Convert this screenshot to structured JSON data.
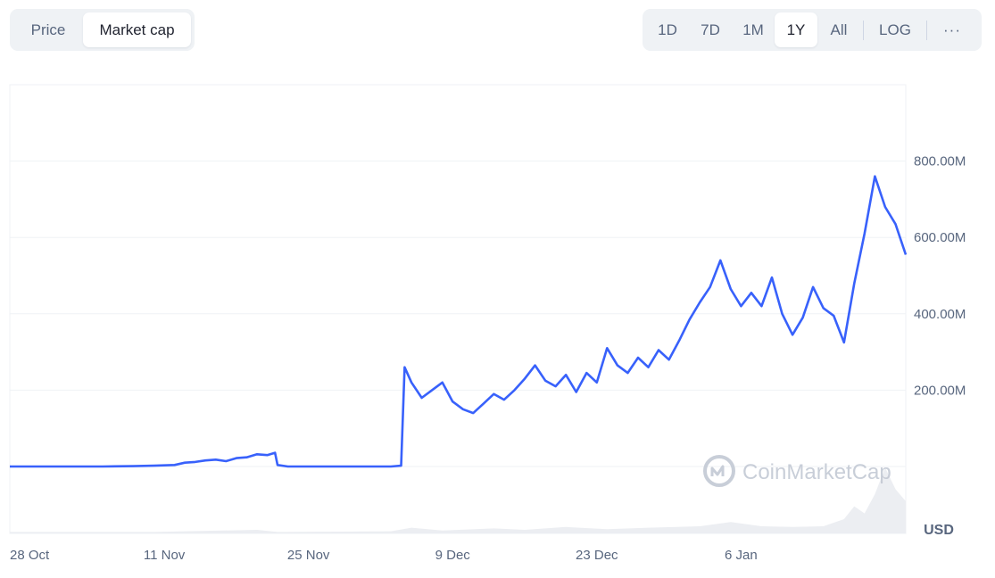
{
  "toggle": {
    "items": [
      {
        "label": "Price",
        "active": false
      },
      {
        "label": "Market cap",
        "active": true
      }
    ]
  },
  "ranges": {
    "items": [
      {
        "label": "1D",
        "active": false
      },
      {
        "label": "7D",
        "active": false
      },
      {
        "label": "1M",
        "active": false
      },
      {
        "label": "1Y",
        "active": true
      },
      {
        "label": "All",
        "active": false
      }
    ],
    "log_label": "LOG",
    "more_label": "···"
  },
  "colors": {
    "line": "#3861fb",
    "volume": "#eceef2",
    "grid": "#eff2f5"
  },
  "watermark": {
    "text": "CoinMarketCap",
    "icon": "coinmarketcap-logo-icon"
  },
  "chart_data": {
    "type": "line",
    "series": [
      {
        "values": [
          [
            "2023-10-27",
            0
          ],
          [
            "2023-11-05",
            0
          ],
          [
            "2023-11-08",
            1
          ],
          [
            "2023-11-10",
            2
          ],
          [
            "2023-11-11",
            3
          ],
          [
            "2023-11-12",
            4
          ],
          [
            "2023-11-13",
            10
          ],
          [
            "2023-11-14",
            12
          ],
          [
            "2023-11-15",
            16
          ],
          [
            "2023-11-16",
            18
          ],
          [
            "2023-11-17",
            14
          ],
          [
            "2023-11-18",
            22
          ],
          [
            "2023-11-19",
            24
          ],
          [
            "2023-11-20",
            32
          ],
          [
            "2023-11-21",
            30
          ],
          [
            "2023-11-21T18:00",
            36
          ],
          [
            "2023-11-22",
            4
          ],
          [
            "2023-11-23",
            0
          ],
          [
            "2023-12-03",
            0
          ],
          [
            "2023-12-04",
            2
          ],
          [
            "2023-12-04T08:00",
            260
          ],
          [
            "2023-12-05",
            220
          ],
          [
            "2023-12-06",
            180
          ],
          [
            "2023-12-07",
            200
          ],
          [
            "2023-12-08",
            220
          ],
          [
            "2023-12-09",
            170
          ],
          [
            "2023-12-10",
            150
          ],
          [
            "2023-12-11",
            140
          ],
          [
            "2023-12-12",
            165
          ],
          [
            "2023-12-13",
            190
          ],
          [
            "2023-12-14",
            175
          ],
          [
            "2023-12-15",
            200
          ],
          [
            "2023-12-16",
            230
          ],
          [
            "2023-12-17",
            265
          ],
          [
            "2023-12-18",
            225
          ],
          [
            "2023-12-19",
            210
          ],
          [
            "2023-12-20",
            240
          ],
          [
            "2023-12-21",
            195
          ],
          [
            "2023-12-22",
            245
          ],
          [
            "2023-12-23",
            220
          ],
          [
            "2023-12-24",
            310
          ],
          [
            "2023-12-25",
            265
          ],
          [
            "2023-12-26",
            245
          ],
          [
            "2023-12-27",
            285
          ],
          [
            "2023-12-28",
            260
          ],
          [
            "2023-12-29",
            305
          ],
          [
            "2023-12-30",
            280
          ],
          [
            "2023-12-31",
            330
          ],
          [
            "2024-01-01",
            385
          ],
          [
            "2024-01-02",
            430
          ],
          [
            "2024-01-03",
            470
          ],
          [
            "2024-01-04",
            540
          ],
          [
            "2024-01-05",
            465
          ],
          [
            "2024-01-06",
            420
          ],
          [
            "2024-01-07",
            455
          ],
          [
            "2024-01-08",
            420
          ],
          [
            "2024-01-09",
            495
          ],
          [
            "2024-01-10",
            400
          ],
          [
            "2024-01-11",
            345
          ],
          [
            "2024-01-12",
            390
          ],
          [
            "2024-01-13",
            470
          ],
          [
            "2024-01-14",
            415
          ],
          [
            "2024-01-15",
            395
          ],
          [
            "2024-01-16",
            325
          ],
          [
            "2024-01-17",
            480
          ],
          [
            "2024-01-18",
            610
          ],
          [
            "2024-01-19",
            760
          ],
          [
            "2024-01-20",
            680
          ],
          [
            "2024-01-21",
            635
          ],
          [
            "2024-01-22",
            555
          ]
        ]
      }
    ],
    "volume": [
      [
        "2023-10-27",
        0.02
      ],
      [
        "2023-11-10",
        0.02
      ],
      [
        "2023-11-20",
        0.05
      ],
      [
        "2023-11-22",
        0.02
      ],
      [
        "2023-12-03",
        0.03
      ],
      [
        "2023-12-05",
        0.08
      ],
      [
        "2023-12-08",
        0.04
      ],
      [
        "2023-12-13",
        0.07
      ],
      [
        "2023-12-16",
        0.05
      ],
      [
        "2023-12-20",
        0.09
      ],
      [
        "2023-12-24",
        0.06
      ],
      [
        "2023-12-28",
        0.08
      ],
      [
        "2024-01-02",
        0.1
      ],
      [
        "2024-01-05",
        0.16
      ],
      [
        "2024-01-08",
        0.1
      ],
      [
        "2024-01-11",
        0.09
      ],
      [
        "2024-01-14",
        0.1
      ],
      [
        "2024-01-16",
        0.2
      ],
      [
        "2024-01-17",
        0.38
      ],
      [
        "2024-01-18",
        0.28
      ],
      [
        "2024-01-19",
        0.55
      ],
      [
        "2024-01-20",
        0.92
      ],
      [
        "2024-01-21",
        0.62
      ],
      [
        "2024-01-22",
        0.45
      ]
    ],
    "x_range": [
      "2023-10-27",
      "2024-01-22"
    ],
    "y_range": [
      0,
      1000
    ],
    "y_ticks": [
      200,
      400,
      600,
      800
    ],
    "y_tick_labels": [
      "200.00M",
      "400.00M",
      "600.00M",
      "800.00M"
    ],
    "x_ticks": [
      "2023-10-28",
      "2023-11-11",
      "2023-11-25",
      "2023-12-09",
      "2023-12-23",
      "2024-01-06"
    ],
    "x_tick_labels": [
      "28 Oct",
      "11 Nov",
      "25 Nov",
      "9 Dec",
      "23 Dec",
      "6 Jan"
    ],
    "unit_label": "USD",
    "grid": true
  }
}
